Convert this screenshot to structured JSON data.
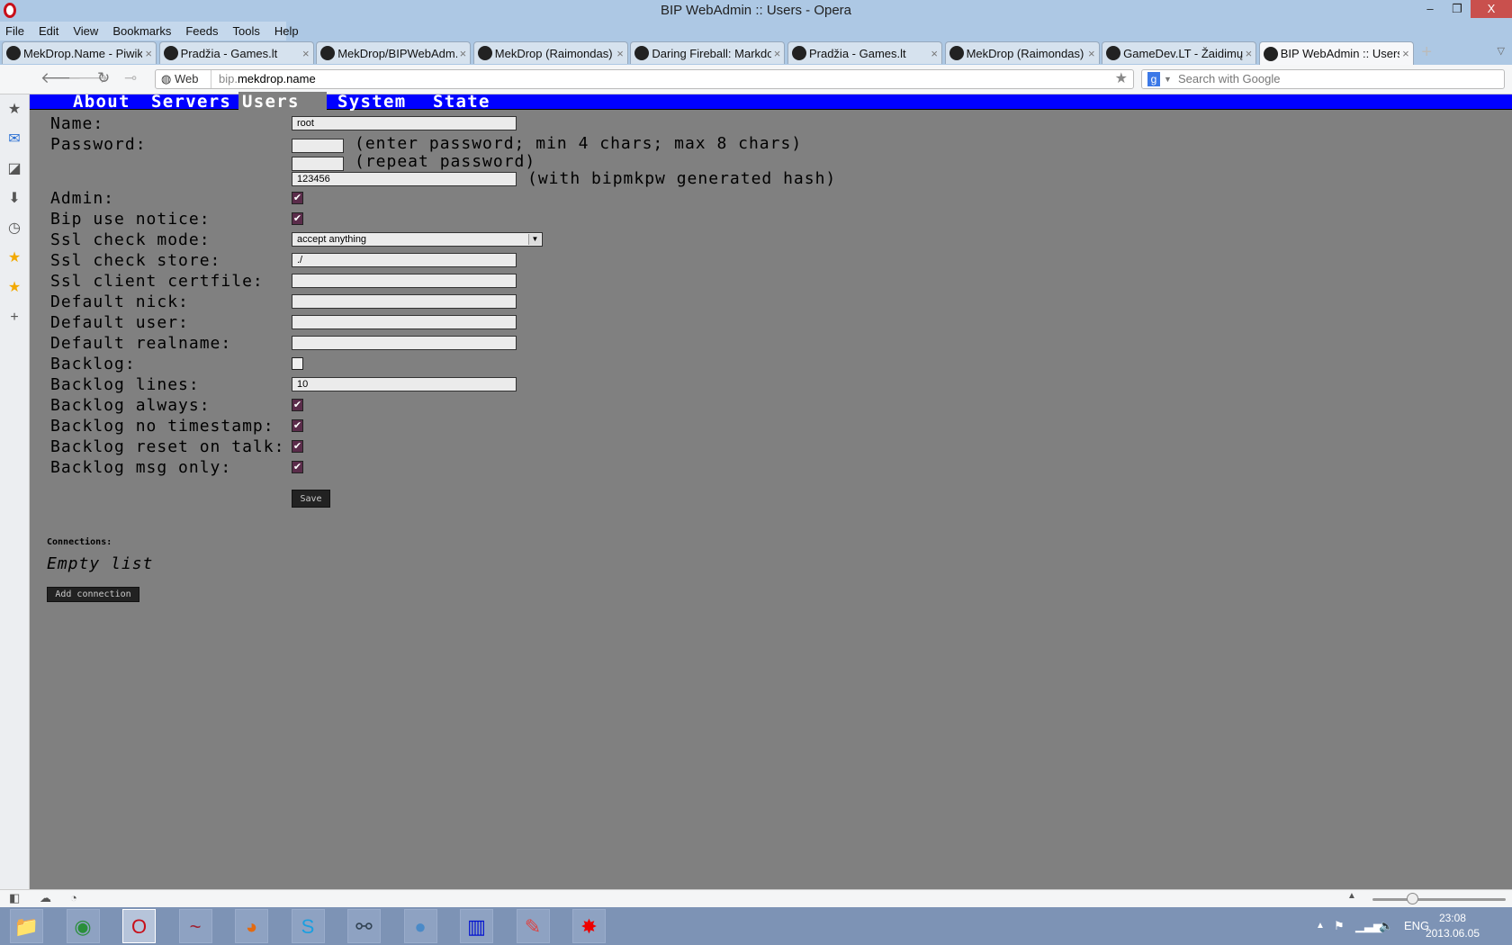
{
  "window": {
    "title": "BIP WebAdmin :: Users - Opera",
    "minimize": "–",
    "restore": "❐",
    "close": "X"
  },
  "menu": [
    "File",
    "Edit",
    "View",
    "Bookmarks",
    "Feeds",
    "Tools",
    "Help"
  ],
  "tabs": [
    {
      "label": "MekDrop.Name - Piwik...",
      "icon": "piwik-icon"
    },
    {
      "label": "Pradžia - Games.lt",
      "icon": "games-lt-icon"
    },
    {
      "label": "MekDrop/BIPWebAdm...",
      "icon": "github-icon"
    },
    {
      "label": "MekDrop (Raimondas)",
      "icon": "github-icon"
    },
    {
      "label": "Daring Fireball: Markdo...",
      "icon": "star-icon"
    },
    {
      "label": "Pradžia - Games.lt",
      "icon": "games-lt-icon"
    },
    {
      "label": "MekDrop (Raimondas)",
      "icon": "github-icon"
    },
    {
      "label": "GameDev.LT - Žaidimų...",
      "icon": "gamedev-icon"
    },
    {
      "label": "BIP WebAdmin :: Users",
      "icon": "page-icon",
      "active": true
    }
  ],
  "address": {
    "badge": "Web",
    "url_prefix": "bip.",
    "url_domain": "mekdrop.name"
  },
  "search": {
    "placeholder": "Search with Google",
    "engine": "g"
  },
  "nav": {
    "items": [
      "About",
      "Servers",
      "Users",
      "System",
      "State"
    ],
    "active": "Users",
    "color": "#0000ff"
  },
  "form": {
    "name_label": "Name:",
    "name_value": "root",
    "password_label": "Password:",
    "password_hint": "(enter password; min 4 chars; max 8 chars)",
    "repeat_hint": "(repeat password)",
    "hash_value": "123456",
    "hash_hint": "(with bipmkpw generated hash)",
    "admin_label": "Admin:",
    "admin": true,
    "bip_use_notice_label": "Bip use notice:",
    "bip_use_notice": true,
    "ssl_check_mode_label": "Ssl check mode:",
    "ssl_check_mode": "accept anything",
    "ssl_check_store_label": "Ssl check store:",
    "ssl_check_store": "./",
    "ssl_client_certfile_label": "Ssl client certfile:",
    "ssl_client_certfile": "",
    "default_nick_label": "Default nick:",
    "default_nick": "",
    "default_user_label": "Default user:",
    "default_user": "",
    "default_realname_label": "Default realname:",
    "default_realname": "",
    "backlog_label": "Backlog:",
    "backlog": false,
    "backlog_lines_label": "Backlog lines:",
    "backlog_lines": "10",
    "backlog_always_label": "Backlog always:",
    "backlog_always": true,
    "backlog_no_timestamp_label": "Backlog no timestamp:",
    "backlog_no_timestamp": true,
    "backlog_reset_on_talk_label": "Backlog reset on talk:",
    "backlog_reset_on_talk": true,
    "backlog_msg_only_label": "Backlog msg only:",
    "backlog_msg_only": true,
    "save_label": "Save"
  },
  "connections": {
    "heading": "Connections:",
    "empty": "Empty list",
    "add_label": "Add connection"
  },
  "taskbar": {
    "apps": [
      "file-explorer-icon",
      "chrome-icon",
      "opera-icon",
      "app-tilde-icon",
      "firefox-icon",
      "skype-icon",
      "network-icon",
      "cat-icon",
      "server-icon",
      "notepad-icon",
      "red-splat-icon"
    ],
    "language": "ENG",
    "time": "23:08",
    "date": "2013.06.05"
  }
}
